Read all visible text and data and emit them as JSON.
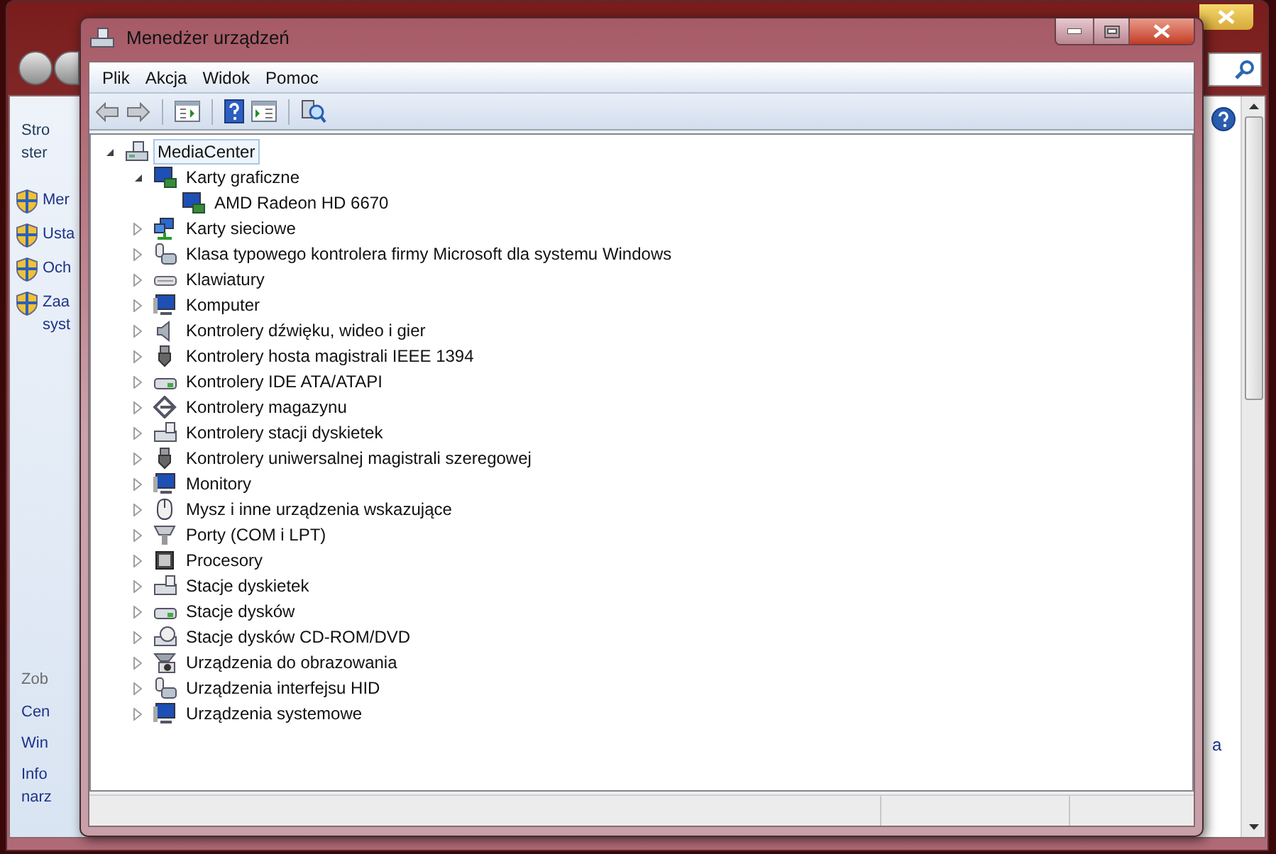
{
  "background_window": {
    "intro": [
      "Stro",
      "ster"
    ],
    "links": [
      {
        "lines": [
          "Mer"
        ]
      },
      {
        "lines": [
          "Usta"
        ]
      },
      {
        "lines": [
          "Och"
        ]
      },
      {
        "lines": [
          "Zaa",
          "syst"
        ]
      }
    ],
    "see_also": {
      "heading": "Zob",
      "links": [
        {
          "lines": [
            "Cen"
          ]
        },
        {
          "lines": [
            "Win"
          ]
        },
        {
          "lines": [
            "Info",
            "narz"
          ]
        }
      ]
    },
    "right_text": "a"
  },
  "window": {
    "title": "Menedżer urządzeń"
  },
  "menu": [
    "Plik",
    "Akcja",
    "Widok",
    "Pomoc"
  ],
  "toolbar": [
    {
      "kind": "back",
      "disabled": true
    },
    {
      "kind": "forward",
      "disabled": true
    },
    {
      "kind": "separator"
    },
    {
      "kind": "tree-view"
    },
    {
      "kind": "separator"
    },
    {
      "kind": "help"
    },
    {
      "kind": "properties"
    },
    {
      "kind": "separator"
    },
    {
      "kind": "scan"
    }
  ],
  "tree": {
    "label": "MediaCenter",
    "kind": "computer",
    "expanded": true,
    "selected": true,
    "children": [
      {
        "label": "Karty graficzne",
        "kind": "display",
        "expanded": true,
        "selected": false,
        "children": [
          {
            "label": "AMD Radeon HD 6670",
            "kind": "display",
            "selected": false
          }
        ]
      },
      {
        "label": "Karty sieciowe",
        "kind": "network",
        "expanded": false,
        "selected": false
      },
      {
        "label": "Klasa typowego kontrolera firmy Microsoft dla systemu Windows",
        "kind": "hid",
        "expanded": false,
        "selected": false
      },
      {
        "label": "Klawiatury",
        "kind": "keyboard",
        "expanded": false,
        "selected": false
      },
      {
        "label": "Komputer",
        "kind": "monitor",
        "expanded": false,
        "selected": false
      },
      {
        "label": "Kontrolery dźwięku, wideo i gier",
        "kind": "sound",
        "expanded": false,
        "selected": false
      },
      {
        "label": "Kontrolery hosta magistrali IEEE 1394",
        "kind": "plug",
        "expanded": false,
        "selected": false
      },
      {
        "label": "Kontrolery IDE ATA/ATAPI",
        "kind": "drive",
        "expanded": false,
        "selected": false
      },
      {
        "label": "Kontrolery magazynu",
        "kind": "storage",
        "expanded": false,
        "selected": false
      },
      {
        "label": "Kontrolery stacji dyskietek",
        "kind": "floppy",
        "expanded": false,
        "selected": false
      },
      {
        "label": "Kontrolery uniwersalnej magistrali szeregowej",
        "kind": "plug",
        "expanded": false,
        "selected": false
      },
      {
        "label": "Monitory",
        "kind": "monitor",
        "expanded": false,
        "selected": false
      },
      {
        "label": "Mysz i inne urządzenia wskazujące",
        "kind": "mouse",
        "expanded": false,
        "selected": false
      },
      {
        "label": "Porty (COM i LPT)",
        "kind": "port",
        "expanded": false,
        "selected": false
      },
      {
        "label": "Procesory",
        "kind": "cpu",
        "expanded": false,
        "selected": false
      },
      {
        "label": "Stacje dyskietek",
        "kind": "floppy",
        "expanded": false,
        "selected": false
      },
      {
        "label": "Stacje dysków",
        "kind": "drive",
        "expanded": false,
        "selected": false
      },
      {
        "label": "Stacje dysków CD-ROM/DVD",
        "kind": "cdrom",
        "expanded": false,
        "selected": false
      },
      {
        "label": "Urządzenia do obrazowania",
        "kind": "camera",
        "expanded": false,
        "selected": false
      },
      {
        "label": "Urządzenia interfejsu HID",
        "kind": "hid",
        "expanded": false,
        "selected": false
      },
      {
        "label": "Urządzenia systemowe",
        "kind": "monitor",
        "expanded": false,
        "selected": false
      }
    ]
  }
}
